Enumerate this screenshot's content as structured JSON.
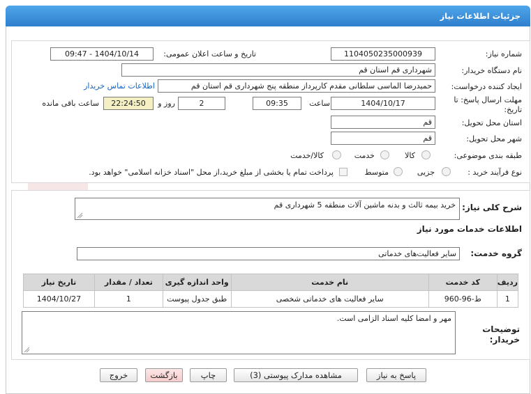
{
  "header": {
    "title": "جزئیات اطلاعات نیاز"
  },
  "form": {
    "need_number_label": "شماره نیاز:",
    "need_number": "1104050235000939",
    "announce_label": "تاریخ و ساعت اعلان عمومی:",
    "announce_value": "1404/10/14 - 09:47",
    "buyer_label": "نام دستگاه خریدار:",
    "buyer_value": "شهرداری قم استان قم",
    "creator_label": "ایجاد کننده درخواست:",
    "creator_value": "حمیدرضا الماسی سلطانی مقدم کارپرداز منطقه پنج شهرداری قم استان قم",
    "contact_link": "اطلاعات تماس خریدار",
    "deadline_label_1": "مهلت ارسال پاسخ: تا",
    "deadline_label_2": "تاریخ:",
    "deadline_date": "1404/10/17",
    "time_label": "ساعت",
    "deadline_time": "09:35",
    "days_value": "2",
    "days_label": "روز و",
    "remaining_value": "22:24:50",
    "remaining_label": "ساعت باقی مانده",
    "province_label": "استان محل تحویل:",
    "province_value": "قم",
    "city_label": "شهر محل تحویل:",
    "city_value": "قم",
    "category_label": "طبقه بندی موضوعی:",
    "category_options": [
      "کالا",
      "خدمت",
      "کالا/خدمت"
    ],
    "process_label": "نوع فرآیند خرید :",
    "process_options": [
      "جزیی",
      "متوسط"
    ],
    "payment_note": "پرداخت تمام یا بخشی از مبلغ خرید،از محل \"اسناد خزانه اسلامی\" خواهد بود."
  },
  "description": {
    "label": "شرح کلی نیاز:",
    "value": "خرید بیمه ثالث و بدنه ماشین آلات منطقه 5 شهرداری قم"
  },
  "services": {
    "section_title": "اطلاعات خدمات مورد نیاز",
    "group_label": "گروه خدمت:",
    "group_value": "سایر فعالیت‌های خدماتی",
    "columns": [
      "ردیف",
      "کد خدمت",
      "نام خدمت",
      "واحد اندازه گیری",
      "تعداد / مقدار",
      "تاریخ نیاز"
    ],
    "rows": [
      [
        "1",
        "ط-96-960",
        "سایر فعالیت های خدماتی شخصی",
        "طبق جدول پیوست",
        "1",
        "1404/10/27"
      ]
    ]
  },
  "buyer_notes": {
    "label_1": "توضیحات",
    "label_2": "خریدار:",
    "value": "مهر و امضا کلیه اسناد الزامی است."
  },
  "buttons": {
    "reply": "پاسخ به نیاز",
    "attachments": "مشاهده مدارک پیوستی (3)",
    "print": "چاپ",
    "back": "بازگشت",
    "exit": "خروج"
  },
  "watermark": {
    "text": "AriaTender.neT"
  }
}
